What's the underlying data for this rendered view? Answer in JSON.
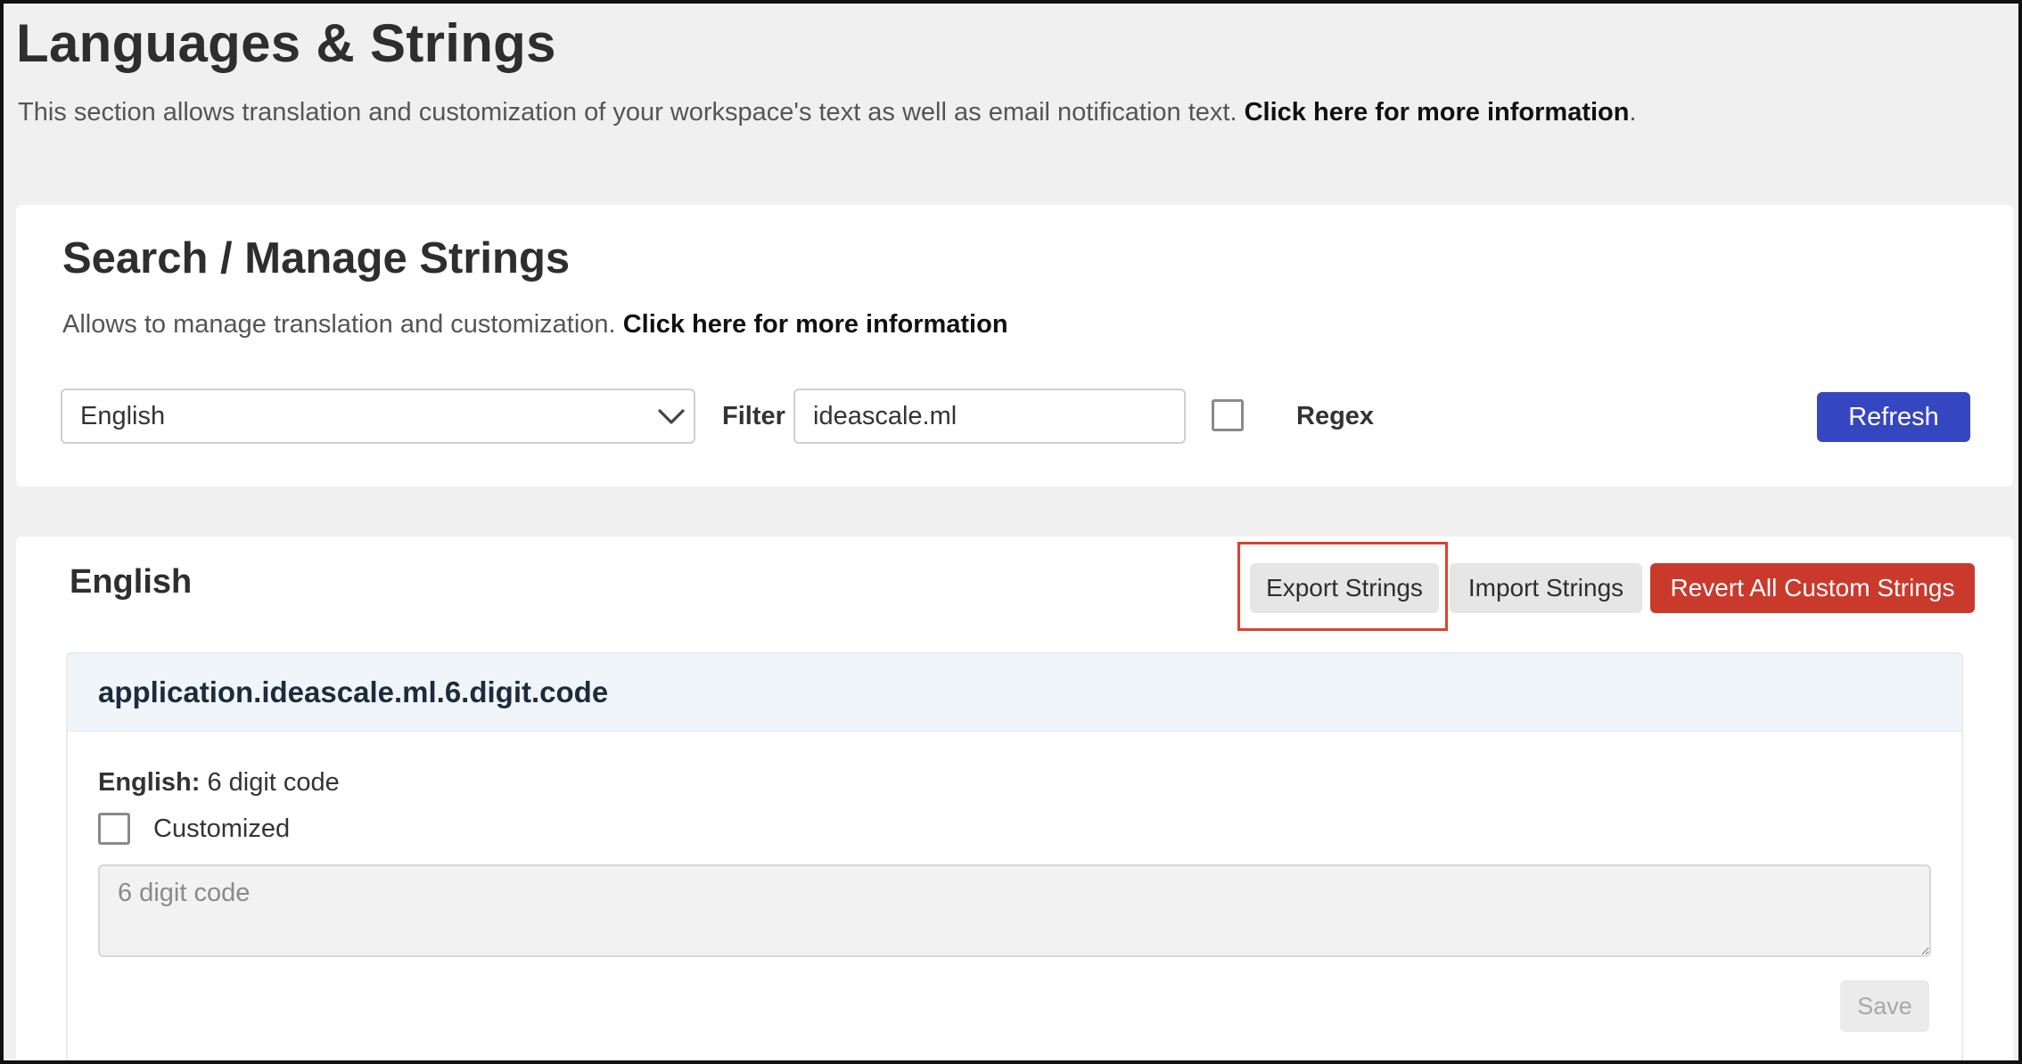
{
  "header": {
    "title": "Languages & Strings",
    "description": "This section allows translation and customization of your workspace's text as well as email notification text.",
    "info_link": "Click here for more information",
    "info_link_suffix": "."
  },
  "search_card": {
    "title": "Search / Manage Strings",
    "description": "Allows to manage translation and customization.",
    "info_link": "Click here for more information",
    "language_select": {
      "selected": "English",
      "icon": "chevron-down-icon"
    },
    "filter_label": "Filter",
    "filter_value": "ideascale.ml",
    "regex_checked": false,
    "regex_label": "Regex",
    "refresh_label": "Refresh"
  },
  "strings_card": {
    "language_heading": "English",
    "export_label": "Export Strings",
    "import_label": "Import Strings",
    "revert_label": "Revert All Custom Strings",
    "items": [
      {
        "key": "application.ideascale.ml.6.digit.code",
        "english_label": "English:",
        "english_value": "6 digit code",
        "customized_checked": false,
        "customized_label": "Customized",
        "placeholder": "6 digit code",
        "save_label": "Save"
      }
    ]
  },
  "colors": {
    "primary": "#3546c1",
    "danger": "#c93a2c",
    "highlight": "#d9432f",
    "page_background": "#f0f0f0"
  }
}
